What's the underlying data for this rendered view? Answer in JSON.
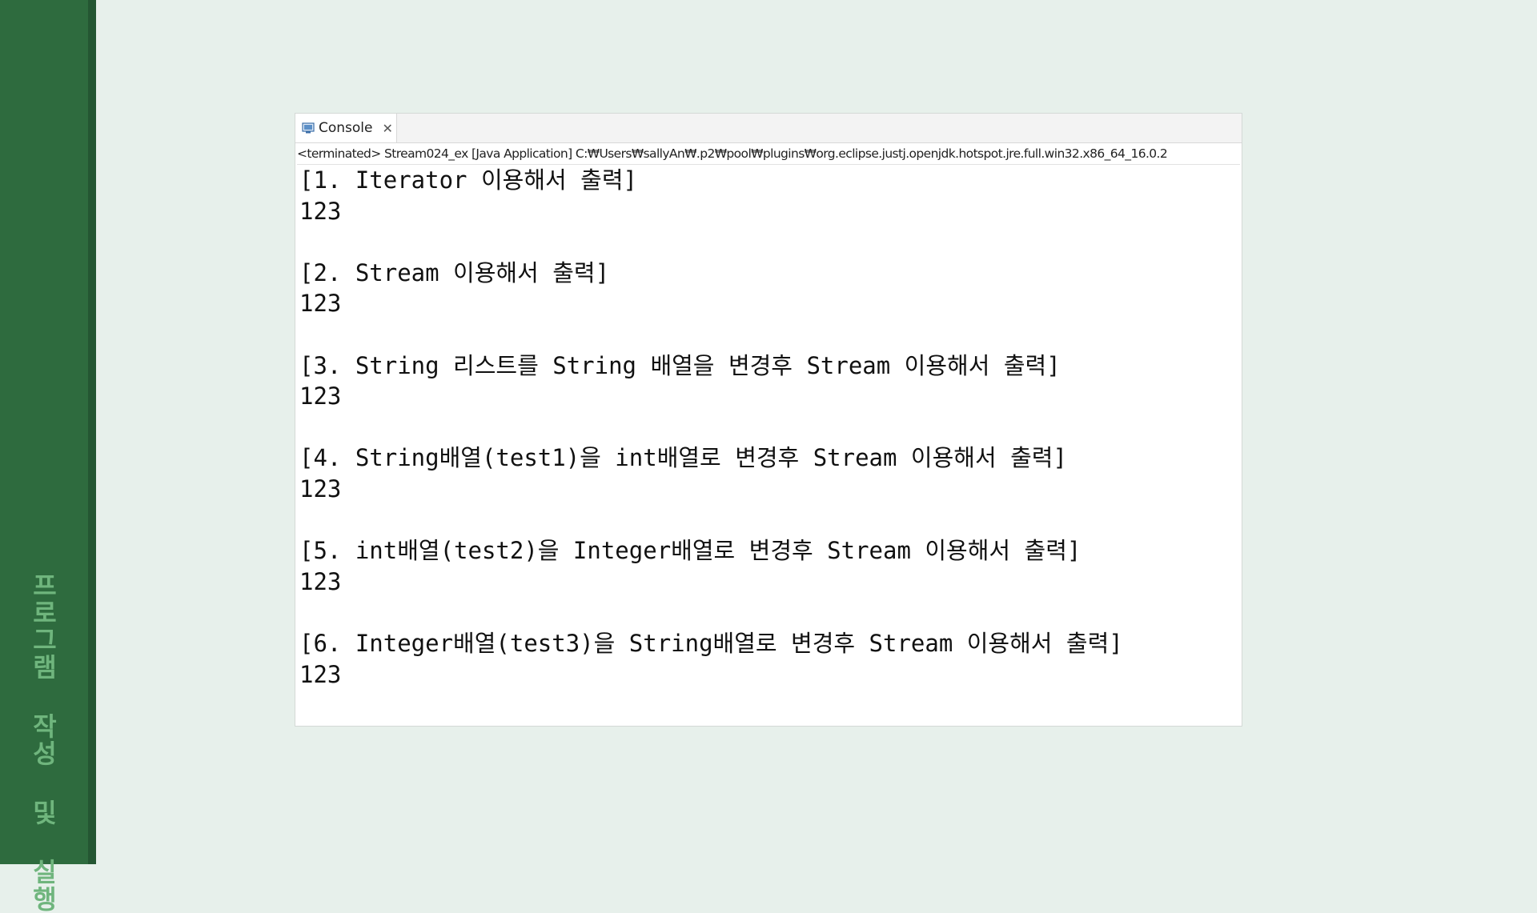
{
  "sidebar": {
    "title": "프로그램 작성 및 실행"
  },
  "console": {
    "tab_label": "Console",
    "tab_icon": "console-icon",
    "close_icon": "close-icon",
    "status": "<terminated> Stream024_ex [Java Application] C:₩Users₩sallyAn₩.p2₩pool₩plugins₩org.eclipse.justj.openjdk.hotspot.jre.full.win32.x86_64_16.0.2",
    "lines": [
      "[1. Iterator 이용해서 출력]",
      "123",
      "",
      "[2. Stream 이용해서 출력]",
      "123",
      "",
      "[3. String 리스트를 String 배열을 변경후 Stream 이용해서 출력]",
      "123",
      "",
      "[4. String배열(test1)을 int배열로 변경후 Stream 이용해서 출력]",
      "123",
      "",
      "[5. int배열(test2)을 Integer배열로 변경후 Stream 이용해서 출력]",
      "123",
      "",
      "[6. Integer배열(test3)을 String배열로 변경후 Stream 이용해서 출력]",
      "123"
    ]
  },
  "colors": {
    "background": "#e7f0eb",
    "sidebar": "#2e6b3e",
    "sidebar_text": "#6fb57d"
  }
}
